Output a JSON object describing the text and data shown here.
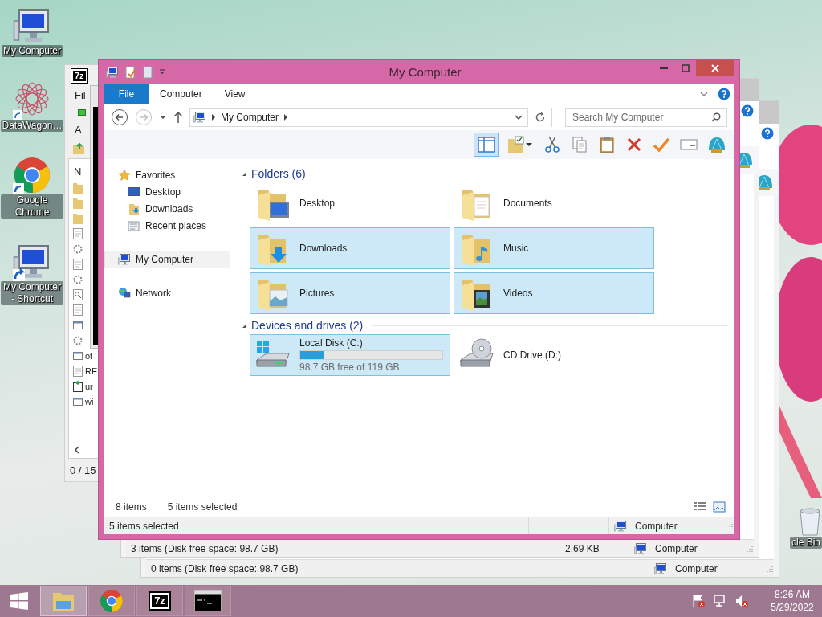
{
  "desktop_icons": [
    {
      "label": "My Computer",
      "kind": "computer",
      "shortcut": false
    },
    {
      "label": "DataWagon…",
      "kind": "star",
      "shortcut": true
    },
    {
      "label": "Google Chrome",
      "kind": "chrome",
      "shortcut": true
    },
    {
      "label": "My Computer - Shortcut",
      "kind": "computer",
      "shortcut": true
    }
  ],
  "recycle_bin": {
    "label": "cle Bin"
  },
  "archive_window": {
    "logo": "7z",
    "menu": "Fil",
    "toolbar_label": "A",
    "column_1": "N",
    "status": "0 / 15",
    "files": [
      {
        "kind": "folder"
      },
      {
        "kind": "folder"
      },
      {
        "kind": "folder"
      },
      {
        "kind": "doc"
      },
      {
        "kind": "gear"
      },
      {
        "kind": "doc"
      },
      {
        "kind": "gear"
      },
      {
        "kind": "search"
      },
      {
        "kind": "doc"
      },
      {
        "kind": "window"
      },
      {
        "kind": "gear"
      },
      {
        "kind": "window",
        "name": "ot"
      },
      {
        "kind": "doc",
        "name": "RE"
      },
      {
        "kind": "setup",
        "name": "ur"
      },
      {
        "kind": "window",
        "name": "wi"
      }
    ]
  },
  "explorer_windows_behind": [
    {
      "status": "3 items (Disk free space: 98.7 GB)",
      "size": "2.69 KB",
      "location": "Computer"
    },
    {
      "status": "0 items (Disk free space: 98.7 GB)",
      "location": "Computer"
    }
  ],
  "window": {
    "title": "My Computer"
  },
  "ribbon_tabs": [
    {
      "label": "File",
      "kind": "file",
      "selected": false
    },
    {
      "label": "Computer",
      "kind": "tab",
      "selected": false
    },
    {
      "label": "View",
      "kind": "tab",
      "selected": false
    }
  ],
  "address": {
    "crumbs": [
      "My Computer"
    ]
  },
  "search": {
    "placeholder": "Search My Computer"
  },
  "nav": [
    {
      "label": "Favorites",
      "kind": "star",
      "selected": false,
      "children": [
        {
          "label": "Desktop",
          "kind": "desktop",
          "selected": false
        },
        {
          "label": "Downloads",
          "kind": "downloads",
          "selected": false
        },
        {
          "label": "Recent places",
          "kind": "recent",
          "selected": false
        }
      ]
    },
    {
      "label": "My Computer",
      "kind": "computer",
      "selected": true
    },
    {
      "label": "Network",
      "kind": "network",
      "selected": false
    }
  ],
  "groups": [
    {
      "title": "Folders (6)",
      "items": [
        {
          "name": "Desktop",
          "kind": "desktop",
          "selected": false
        },
        {
          "name": "Documents",
          "kind": "documents",
          "selected": false
        },
        {
          "name": "Downloads",
          "kind": "downloads",
          "selected": true
        },
        {
          "name": "Music",
          "kind": "music",
          "selected": true
        },
        {
          "name": "Pictures",
          "kind": "pictures",
          "selected": true
        },
        {
          "name": "Videos",
          "kind": "videos",
          "selected": true
        }
      ]
    },
    {
      "title": "Devices and drives (2)",
      "items": [
        {
          "name": "Local Disk (C:)",
          "kind": "disk",
          "selected": true,
          "level": 0.17,
          "free": "98.7 GB free of 119 GB"
        },
        {
          "name": "CD Drive (D:)",
          "kind": "cd",
          "selected": false
        }
      ]
    }
  ],
  "pane_status": {
    "count": "8 items",
    "selection": "5 items selected"
  },
  "status_bar": {
    "text": "5 items selected",
    "location": "Computer"
  },
  "taskbar": {
    "apps": [
      {
        "kind": "explorer",
        "selected": true
      },
      {
        "kind": "chrome",
        "selected": false
      },
      {
        "kind": "archiver",
        "logo": "7z",
        "selected": false
      },
      {
        "kind": "console",
        "selected": false
      }
    ],
    "time": "8:26 AM",
    "date": "5/29/2022"
  }
}
